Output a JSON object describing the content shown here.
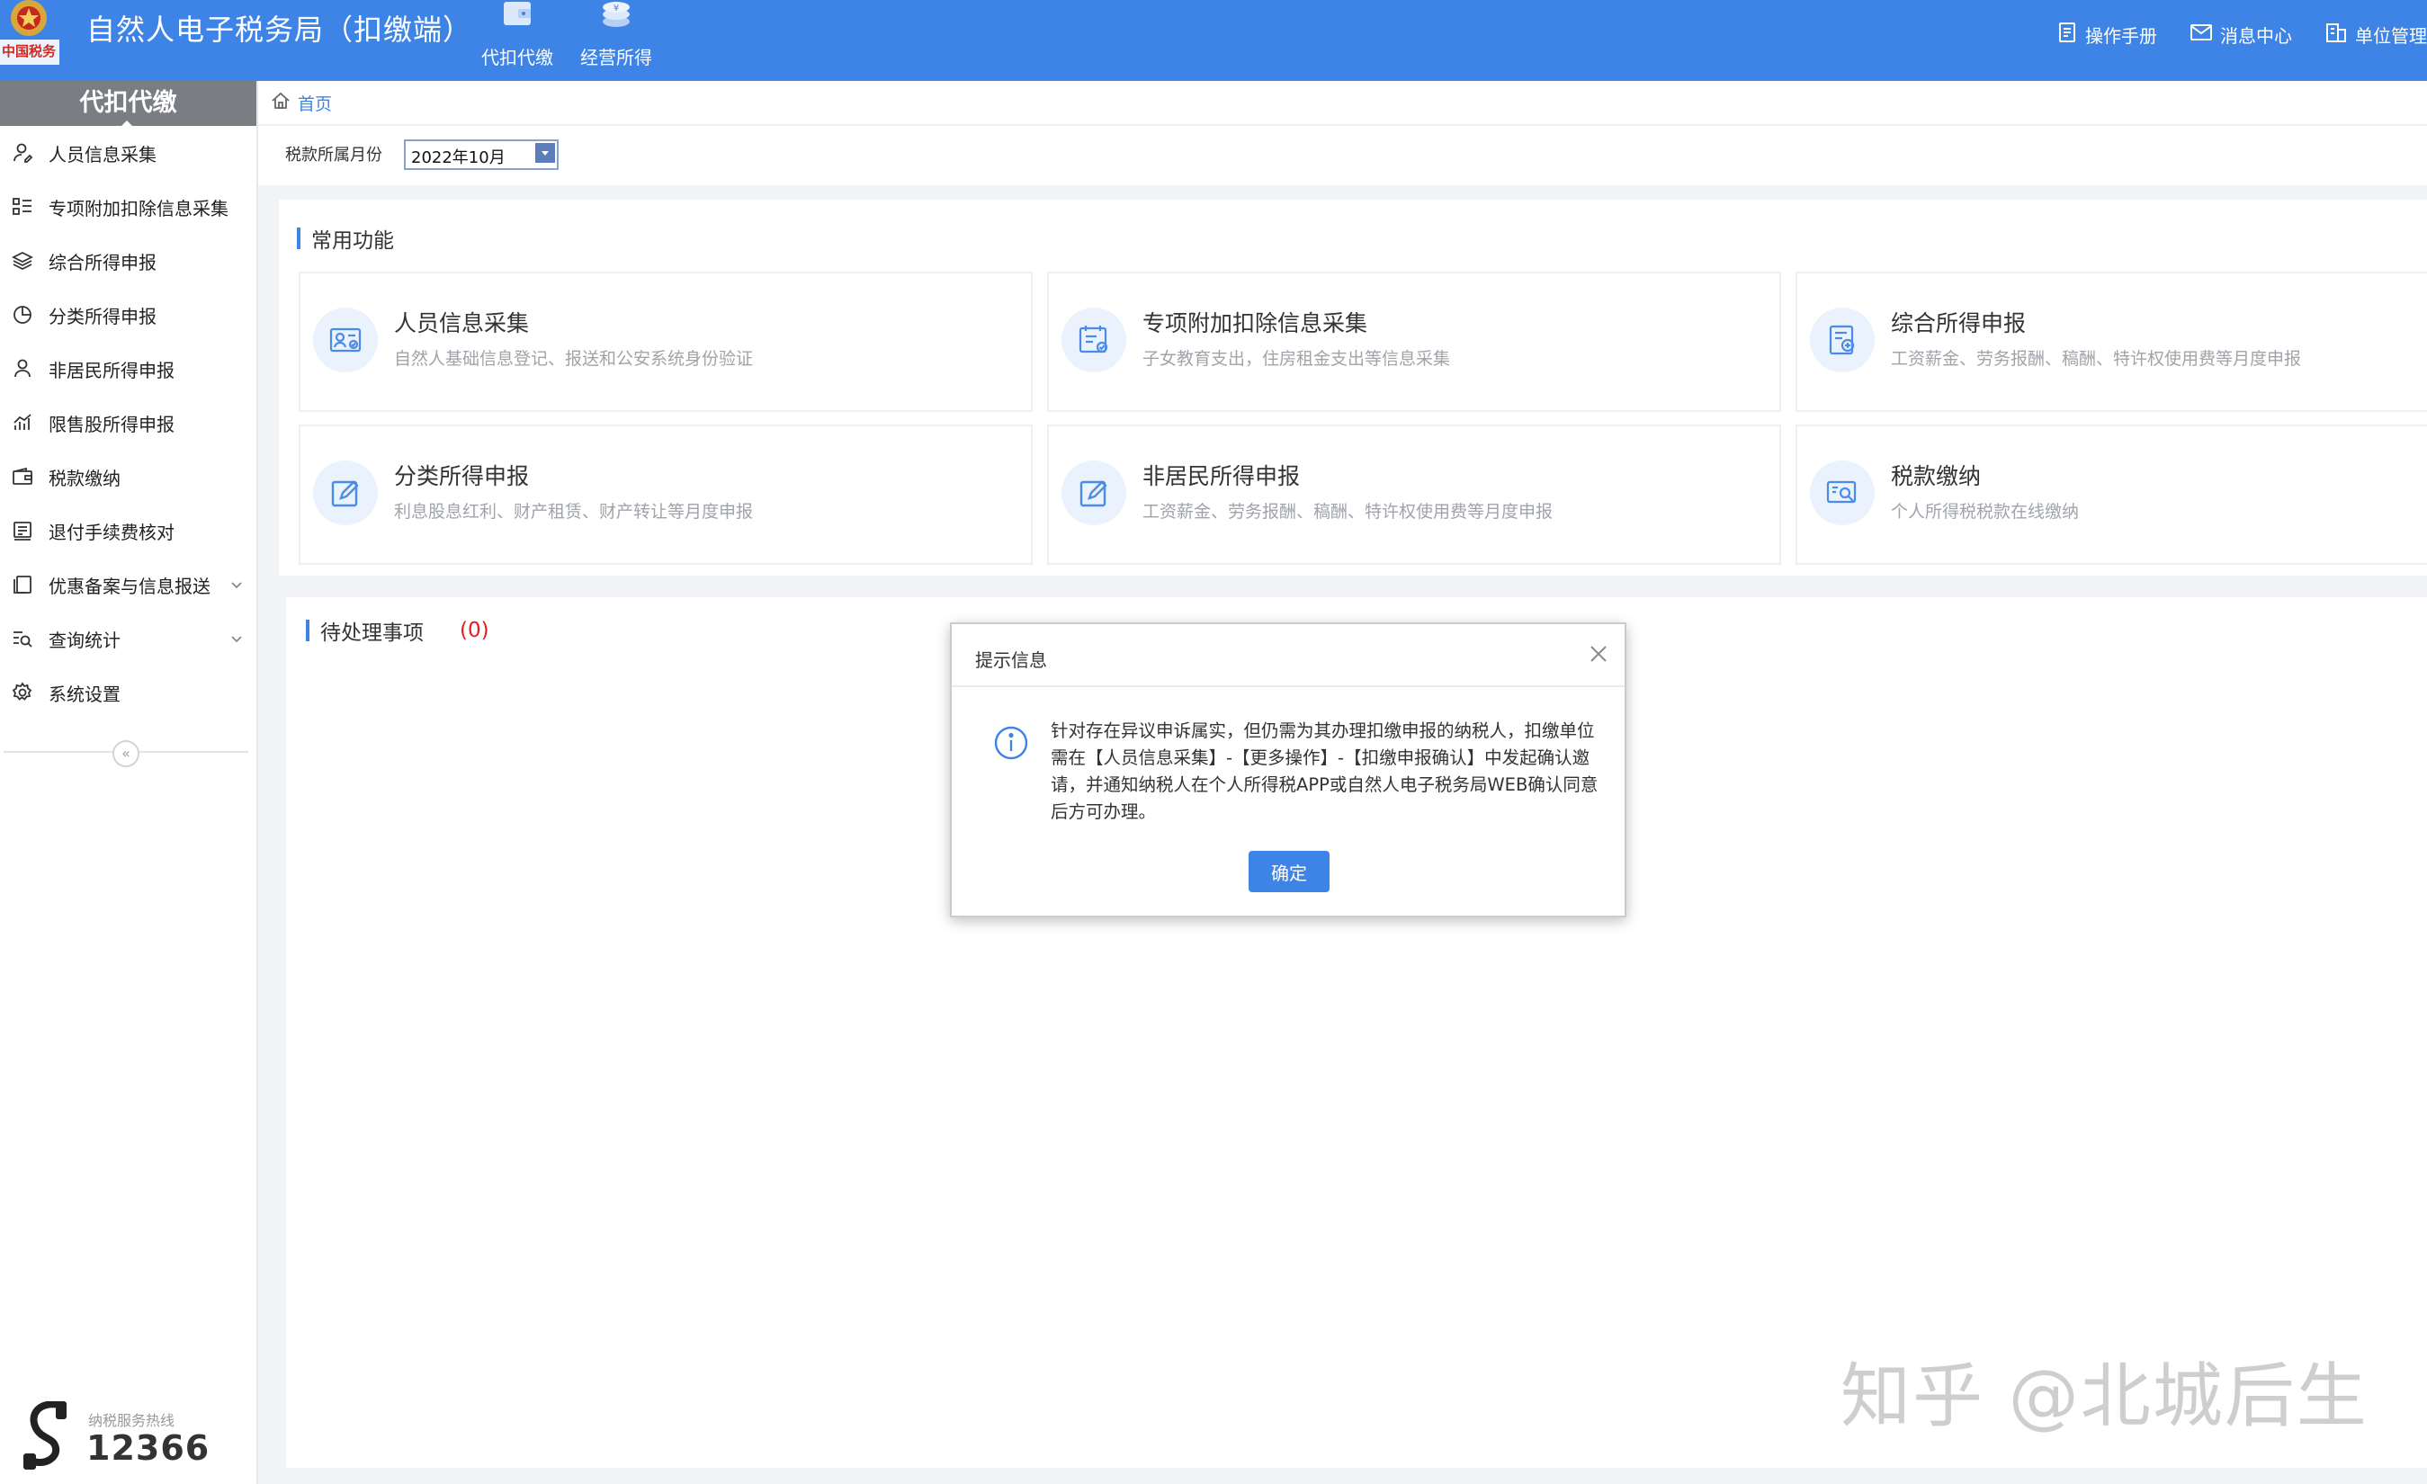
{
  "header": {
    "app_title": "自然人电子税务局（扣缴端）",
    "emblem_caption": "中国税务",
    "top_nav": [
      {
        "label": "代扣代缴",
        "icon": "wallet-icon"
      },
      {
        "label": "经营所得",
        "icon": "coin-stack-icon"
      }
    ],
    "links": [
      {
        "label": "操作手册",
        "icon": "manual-icon"
      },
      {
        "label": "消息中心",
        "icon": "envelope-icon"
      },
      {
        "label": "单位管理",
        "icon": "building-icon"
      }
    ]
  },
  "sidebar": {
    "title": "代扣代缴",
    "items": [
      {
        "label": "人员信息采集",
        "icon": "person-edit-icon"
      },
      {
        "label": "专项附加扣除信息采集",
        "icon": "list-grid-icon"
      },
      {
        "label": "综合所得申报",
        "icon": "layers-icon"
      },
      {
        "label": "分类所得申报",
        "icon": "pie-chart-icon"
      },
      {
        "label": "非居民所得申报",
        "icon": "person-icon"
      },
      {
        "label": "限售股所得申报",
        "icon": "bar-chart-icon"
      },
      {
        "label": "税款缴纳",
        "icon": "wallet-icon"
      },
      {
        "label": "退付手续费核对",
        "icon": "document-icon"
      },
      {
        "label": "优惠备案与信息报送",
        "icon": "copy-icon",
        "expandable": true
      },
      {
        "label": "查询统计",
        "icon": "search-list-icon",
        "expandable": true
      },
      {
        "label": "系统设置",
        "icon": "gear-icon"
      }
    ],
    "collapse_symbol": "«",
    "hotline_caption": "纳税服务热线",
    "hotline_number": "12366"
  },
  "breadcrumb": {
    "home": "首页"
  },
  "month": {
    "label": "税款所属月份",
    "value": "2022年10月"
  },
  "common": {
    "title": "常用功能",
    "cards": [
      {
        "title": "人员信息采集",
        "desc": "自然人基础信息登记、报送和公安系统身份验证",
        "icon": "id-card-icon"
      },
      {
        "title": "专项附加扣除信息采集",
        "desc": "子女教育支出，住房租金支出等信息采集",
        "icon": "deduction-form-icon"
      },
      {
        "title": "综合所得申报",
        "desc": "工资薪金、劳务报酬、稿酬、特许权使用费等月度申报",
        "icon": "report-add-icon"
      },
      {
        "title": "分类所得申报",
        "desc": "利息股息红利、财产租赁、财产转让等月度申报",
        "icon": "edit-icon"
      },
      {
        "title": "非居民所得申报",
        "desc": "工资薪金、劳务报酬、稿酬、特许权使用费等月度申报",
        "icon": "edit-icon"
      },
      {
        "title": "税款缴纳",
        "desc": "个人所得税税款在线缴纳",
        "icon": "payment-search-icon"
      }
    ]
  },
  "pending": {
    "title": "待处理事项",
    "count": "(0)"
  },
  "modal": {
    "title": "提示信息",
    "message": "针对存在异议申诉属实，但仍需为其办理扣缴申报的纳税人，扣缴单位需在【人员信息采集】-【更多操作】-【扣缴申报确认】中发起确认邀请，并通知纳税人在个人所得税APP或自然人电子税务局WEB确认同意后方可办理。",
    "ok_label": "确定"
  },
  "watermark": "知乎 @北城后生",
  "colors": {
    "primary": "#3d84e6",
    "danger": "#e02020",
    "sidebar_head": "#7a7d82"
  }
}
